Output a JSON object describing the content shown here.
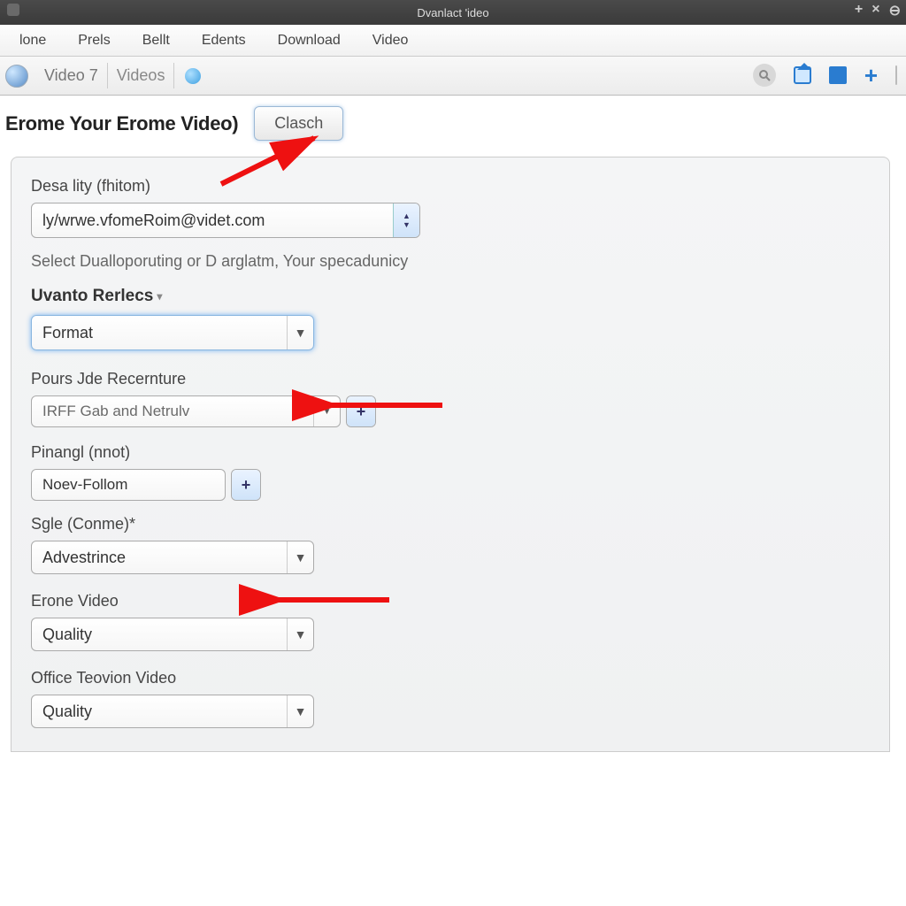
{
  "window": {
    "title": "Dvanlact 'ideo"
  },
  "menu": [
    "lone",
    "Prels",
    "Bellt",
    "Edents",
    "Download",
    "Video"
  ],
  "tabs": {
    "active": "Video 7",
    "second": "Videos"
  },
  "page": {
    "heading": "Erome Your Erome Video)",
    "action_button": "Clasch"
  },
  "form": {
    "url_label": "Desa lity (fhitom)",
    "url_value": "ly/wrwe.vfomeRoim@videt.com",
    "helper": "Select Dualloporuting or D arglatm, Your specadunicy",
    "section_label": "Uvanto  Rerlecs",
    "format": {
      "value": "Format"
    },
    "recenture": {
      "label": "Pours Jde Recernture",
      "value": "IRFF Gab and Netrulv"
    },
    "pinang": {
      "label": "Pinangl (nnot)",
      "value": "Noev-Follom"
    },
    "sgle": {
      "label": "Sgle (Conme)*",
      "value": "Advestrince"
    },
    "erone": {
      "label": "Erone Video",
      "value": "Quality"
    },
    "office": {
      "label": "Office Teovion Video",
      "value": "Quality"
    }
  }
}
